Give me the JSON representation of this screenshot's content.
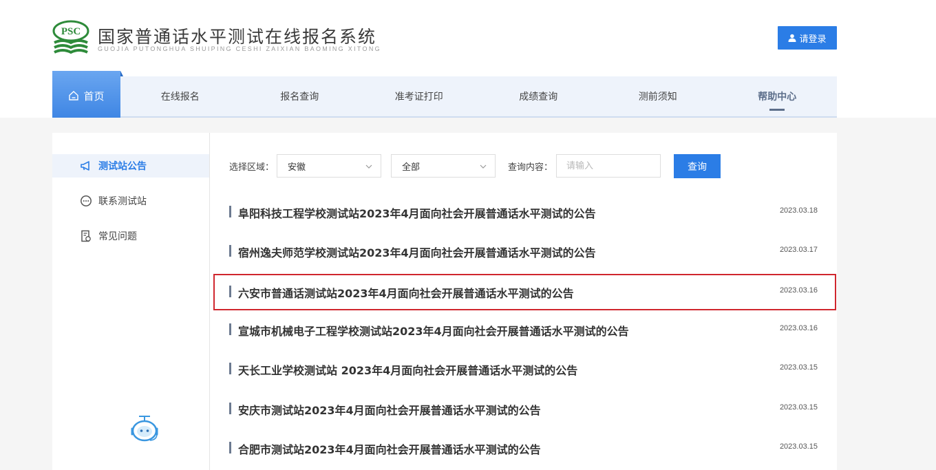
{
  "header": {
    "logo_text": "PSC",
    "title": "国家普通话水平测试在线报名系统",
    "subtitle": "GUOJIA PUTONGHUA SHUIPING CESHI ZAIXIAN BAOMING XITONG",
    "login_label": "请登录"
  },
  "nav": {
    "home": "首页",
    "items": [
      "在线报名",
      "报名查询",
      "准考证打印",
      "成绩查询",
      "测前须知",
      "帮助中心"
    ],
    "active_index": 5
  },
  "sidebar": {
    "items": [
      {
        "label": "测试站公告",
        "icon": "megaphone-icon",
        "active": true
      },
      {
        "label": "联系测试站",
        "icon": "chat-bubble-icon",
        "active": false
      },
      {
        "label": "常见问题",
        "icon": "document-question-icon",
        "active": false
      }
    ]
  },
  "filter": {
    "region_label": "选择区域：",
    "province_value": "安徽",
    "city_value": "全部",
    "query_label": "查询内容：",
    "query_placeholder": "请输入",
    "query_button": "查询"
  },
  "notices": [
    {
      "title": "阜阳科技工程学校测试站2023年4月面向社会开展普通话水平测试的公告",
      "date": "2023.03.18",
      "highlighted": false
    },
    {
      "title": "宿州逸夫师范学校测试站2023年4月面向社会开展普通话水平测试的公告",
      "date": "2023.03.17",
      "highlighted": false
    },
    {
      "title": "六安市普通话测试站2023年4月面向社会开展普通话水平测试的公告",
      "date": "2023.03.16",
      "highlighted": true
    },
    {
      "title": "宣城市机械电子工程学校测试站2023年4月面向社会开展普通话水平测试的公告",
      "date": "2023.03.16",
      "highlighted": false
    },
    {
      "title": "天长工业学校测试站 2023年4月面向社会开展普通话水平测试的公告",
      "date": "2023.03.15",
      "highlighted": false
    },
    {
      "title": "安庆市测试站2023年4月面向社会开展普通话水平测试的公告",
      "date": "2023.03.15",
      "highlighted": false
    },
    {
      "title": "合肥市测试站2023年4月面向社会开展普通话水平测试的公告",
      "date": "2023.03.15",
      "highlighted": false
    }
  ],
  "colors": {
    "accent": "#2b7de6",
    "logo_green": "#2e8b3a",
    "highlight_border": "#d0262d",
    "nav_bg": "#eef3fb"
  }
}
